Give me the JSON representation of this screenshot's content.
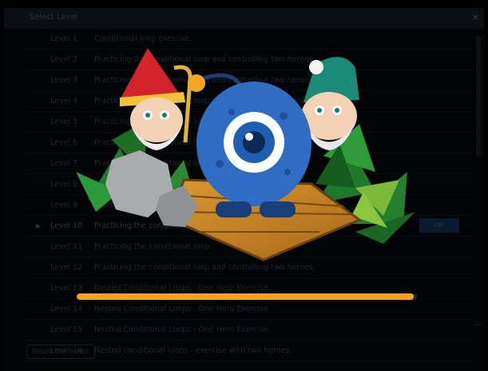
{
  "dialog": {
    "title": "Select Level",
    "close_icon": "close-icon",
    "reset_label": "Reset the levels",
    "ok_label": "OK"
  },
  "levels": [
    {
      "label": "Level 1",
      "desc": "Conditional loop exercise."
    },
    {
      "label": "Level 2",
      "desc": "Practicing the conditional loop and controlling two heroes."
    },
    {
      "label": "Level 3",
      "desc": "Practicing the conditional loop and controlling two heroes."
    },
    {
      "label": "Level 4",
      "desc": "Practicing the conditional loop and controlling two heroes."
    },
    {
      "label": "Level 5",
      "desc": "Practicing the conditional loop."
    },
    {
      "label": "Level 6",
      "desc": "Practicing the conditional loop."
    },
    {
      "label": "Level 7",
      "desc": "Practicing the conditional loop."
    },
    {
      "label": "Level 8",
      "desc": "Practicing the conditional loop."
    },
    {
      "label": "Level 9",
      "desc": "Practicing the conditional loop."
    },
    {
      "label": "Level 10",
      "desc": "Practicing the conditional loop."
    },
    {
      "label": "Level 11",
      "desc": "Practicing the conditional loop."
    },
    {
      "label": "Level 12",
      "desc": "Practicing the conditional loop and controlling two heroes."
    },
    {
      "label": "Level 13",
      "desc": "Nested Conditional Loops - One Hero Exercise."
    },
    {
      "label": "Level 14",
      "desc": "Nested Conditional Loops - One Hero Exercise."
    },
    {
      "label": "Level 15",
      "desc": "Nested Conditional Loops - One Hero Exercise."
    },
    {
      "label": "Level 16",
      "desc": "Nested conditional loops - exercise with two heroes."
    }
  ],
  "selected_level_index": 9,
  "loading": {
    "progress": 0.99,
    "color": "#f7a21b"
  },
  "colors": {
    "accent": "#f7a21b",
    "monster_blue": "#2f6cc4",
    "wood": "#c9892a"
  },
  "icons": {
    "scroll_up": "chevron-up-icon",
    "scroll_down": "chevron-down-icon",
    "selected_marker": "play-arrow-icon"
  }
}
